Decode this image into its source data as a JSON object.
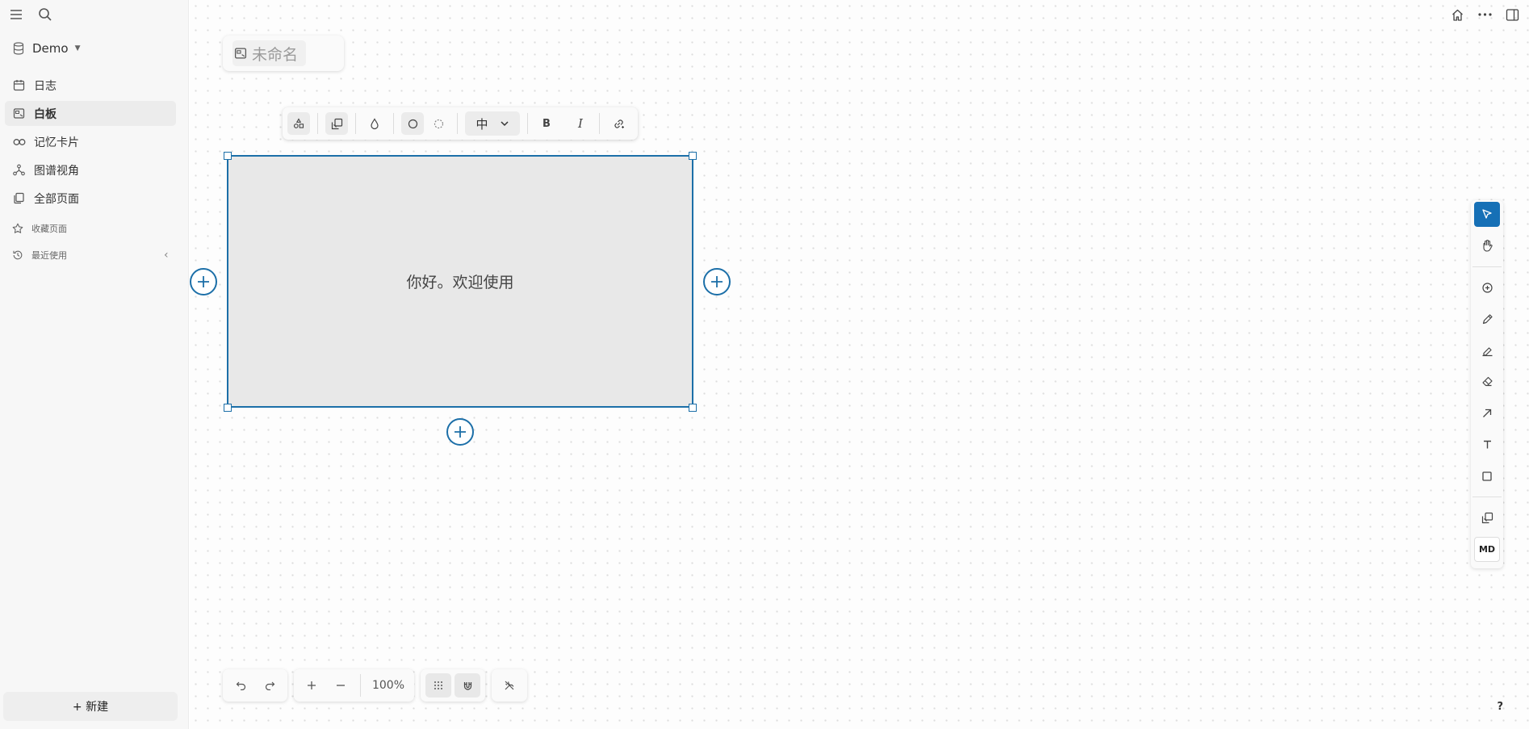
{
  "sidebar": {
    "graph_name": "Demo",
    "nav": [
      {
        "label": "日志",
        "icon": "calendar-icon"
      },
      {
        "label": "白板",
        "icon": "whiteboard-icon",
        "active": true
      },
      {
        "label": "记忆卡片",
        "icon": "infinity-icon"
      },
      {
        "label": "图谱视角",
        "icon": "graph-icon"
      },
      {
        "label": "全部页面",
        "icon": "pages-icon"
      }
    ],
    "favorites_label": "收藏页面",
    "recent_label": "最近使用",
    "new_label": "+ 新建"
  },
  "whiteboard": {
    "title_placeholder": "未命名",
    "shape_text": "你好。欢迎使用",
    "font_size_label": "中",
    "bold_label": "B",
    "italic_label": "I"
  },
  "tools": {
    "md_label": "MD",
    "active": "select"
  },
  "bottom": {
    "zoom": "100%"
  },
  "help_label": "?",
  "colors": {
    "accent": "#1670b6",
    "shape_fill": "#e8e8e8",
    "shape_border": "#1c6fa8"
  }
}
